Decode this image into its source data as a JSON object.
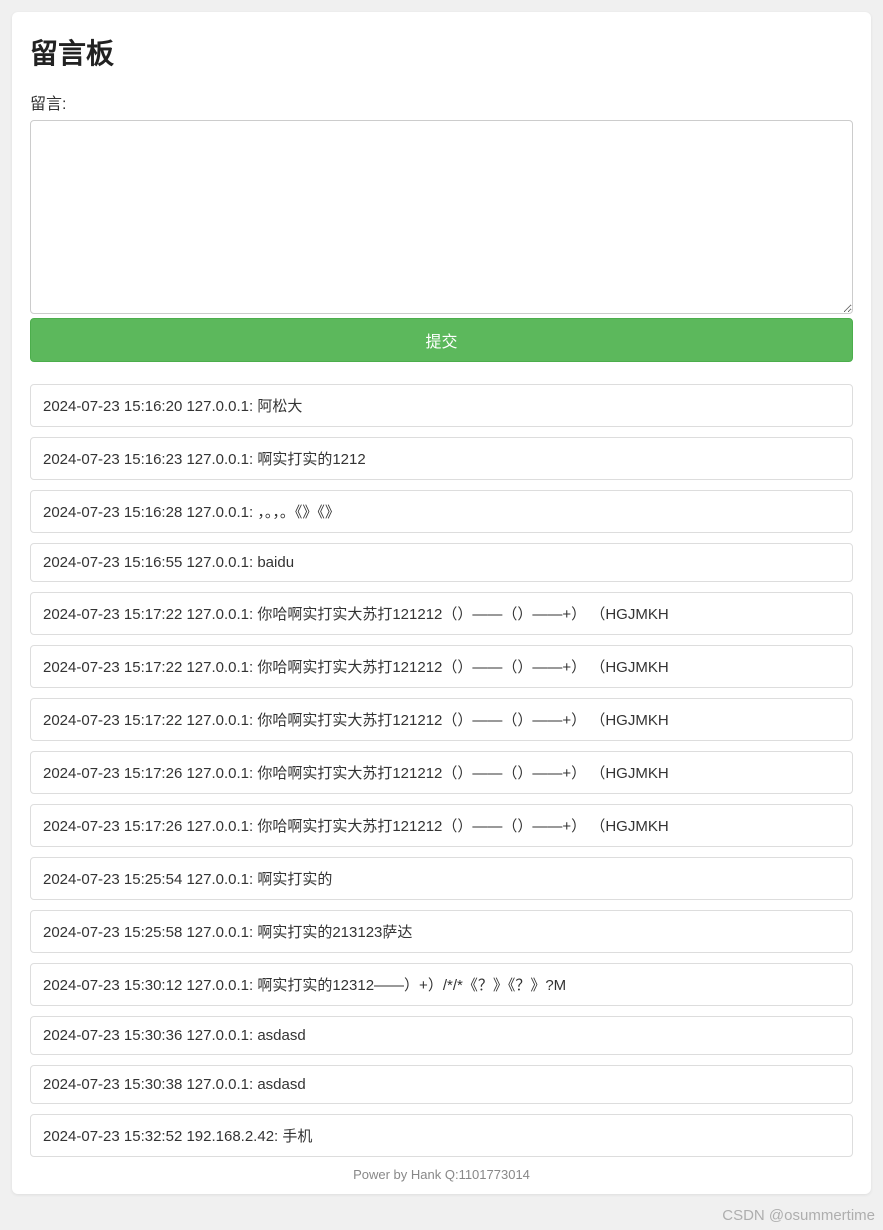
{
  "page": {
    "title": "留言板",
    "form_label": "留言:",
    "textarea_value": "",
    "submit_label": "提交",
    "footer_text": "Power by Hank Q:1101773014",
    "watermark": "CSDN @osummertime"
  },
  "messages": [
    {
      "text": "2024-07-23 15:16:20 127.0.0.1: 阿松大"
    },
    {
      "text": "2024-07-23 15:16:23 127.0.0.1: 啊实打实的1212"
    },
    {
      "text": "2024-07-23 15:16:28 127.0.0.1: ，。，。《》《》"
    },
    {
      "text": "2024-07-23 15:16:55 127.0.0.1: baidu"
    },
    {
      "text": "2024-07-23 15:17:22 127.0.0.1: 你哈啊实打实大苏打121212（）——（）——+）  （HGJMKH"
    },
    {
      "text": "2024-07-23 15:17:22 127.0.0.1: 你哈啊实打实大苏打121212（）——（）——+）  （HGJMKH"
    },
    {
      "text": "2024-07-23 15:17:22 127.0.0.1: 你哈啊实打实大苏打121212（）——（）——+）  （HGJMKH"
    },
    {
      "text": "2024-07-23 15:17:26 127.0.0.1: 你哈啊实打实大苏打121212（）——（）——+）  （HGJMKH"
    },
    {
      "text": "2024-07-23 15:17:26 127.0.0.1: 你哈啊实打实大苏打121212（）——（）——+）  （HGJMKH"
    },
    {
      "text": "2024-07-23 15:25:54 127.0.0.1: 啊实打实的"
    },
    {
      "text": "2024-07-23 15:25:58 127.0.0.1: 啊实打实的213123萨达"
    },
    {
      "text": "2024-07-23 15:30:12 127.0.0.1: 啊实打实的12312——）+）/*/*《？》《？》?M"
    },
    {
      "text": "2024-07-23 15:30:36 127.0.0.1: asdasd"
    },
    {
      "text": "2024-07-23 15:30:38 127.0.0.1: asdasd"
    },
    {
      "text": "2024-07-23 15:32:52 192.168.2.42: 手机"
    }
  ]
}
